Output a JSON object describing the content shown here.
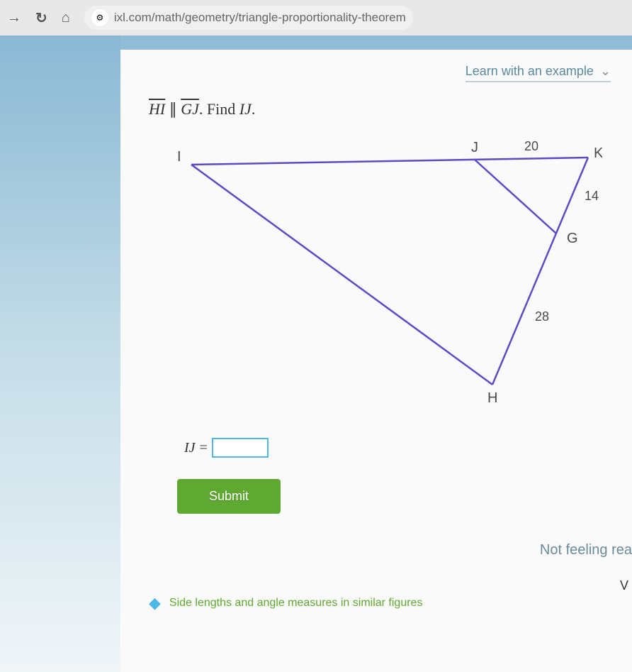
{
  "browser": {
    "url": "ixl.com/math/geometry/triangle-proportionality-theorem"
  },
  "header": {
    "learn_label": "Learn with an example"
  },
  "problem": {
    "segment1": "HI",
    "parallel": "∥",
    "segment2": "GJ",
    "instruction": ". Find ",
    "target": "IJ",
    "period": "."
  },
  "diagram": {
    "vertices": {
      "I": "I",
      "J": "J",
      "K": "K",
      "G": "G",
      "H": "H"
    },
    "sides": {
      "JK": "20",
      "KG": "14",
      "GH": "28"
    }
  },
  "answer": {
    "label": "IJ",
    "equals": "=",
    "value": ""
  },
  "buttons": {
    "submit": "Submit"
  },
  "footer": {
    "not_feeling": "Not feeling rea",
    "right_char": "V",
    "related_link": "Side lengths and angle measures in similar figures"
  }
}
